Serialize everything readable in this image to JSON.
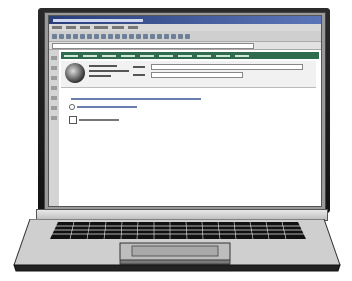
{
  "device": "laptop",
  "screen_app": {
    "window": "browser",
    "accent_color": "#2f6b4d",
    "titlebar_color": "#2a3f7a"
  },
  "icons": [
    "avatar",
    "radio",
    "checkbox"
  ]
}
